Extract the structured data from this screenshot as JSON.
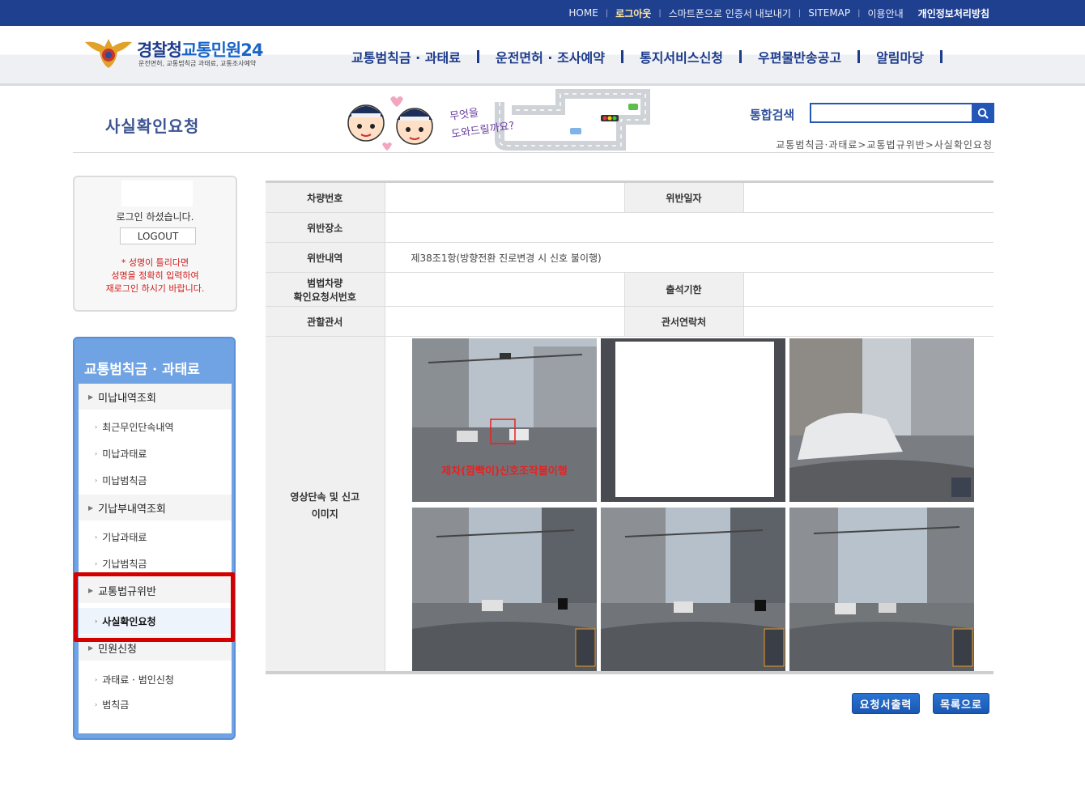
{
  "top_links": {
    "home": "HOME",
    "logout": "로그아웃",
    "export_cert": "스마트폰으로 인증서 내보내기",
    "sitemap": "SITEMAP",
    "guide": "이용안내",
    "privacy": "개인정보처리방침"
  },
  "logo": {
    "title_a": "경찰청",
    "title_b": "교통민원24",
    "subtitle": "운전면허, 교통범칙금 과태료, 교통조사예약"
  },
  "gnb": [
    "교통범칙금 · 과태료",
    "운전면허 · 조사예약",
    "통지서비스신청",
    "우편물반송공고",
    "알림마당"
  ],
  "page_title": "사실확인요청",
  "mascot_text": [
    "무엇을",
    "도와드릴까요?"
  ],
  "search": {
    "label": "통합검색",
    "placeholder": ""
  },
  "breadcrumb": "교통범칙금·과태료>교통법규위반>사실확인요청",
  "login": {
    "message": "로그인 하셨습니다.",
    "logout_label": "LOGOUT",
    "warning": [
      "* 성명이 틀리다면",
      "성명을 정확히 입력하여",
      "재로그인 하시기 바랍니다."
    ]
  },
  "lnb": {
    "title": "교통범칙금 · 과태료",
    "items": [
      {
        "label": "미납내역조회",
        "level": 1
      },
      {
        "label": "최근무인단속내역",
        "level": 2
      },
      {
        "label": "미납과태료",
        "level": 2
      },
      {
        "label": "미납범칙금",
        "level": 2
      },
      {
        "label": "기납부내역조회",
        "level": 1
      },
      {
        "label": "기납과태료",
        "level": 2
      },
      {
        "label": "기납범칙금",
        "level": 2
      },
      {
        "label": "교통법규위반",
        "level": 1
      },
      {
        "label": "사실확인요청",
        "level": 2,
        "active": true
      },
      {
        "label": "민원신청",
        "level": 1
      },
      {
        "label": "과태료 · 범인신청",
        "level": 2
      },
      {
        "label": "범칙금",
        "level": 2
      }
    ]
  },
  "detail": {
    "vehicle_no_label": "차량번호",
    "vehicle_no_value": "",
    "violation_date_label": "위반일자",
    "violation_date_value": "",
    "place_label": "위반장소",
    "place_value": "",
    "content_label": "위반내역",
    "content_value": "제38조1항(방향전환 진로변경 시 신호 불이행)",
    "request_no_label_1": "범법차량",
    "request_no_label_2": "확인요청서번호",
    "request_no_value": "",
    "deadline_label": "출석기한",
    "deadline_value": "",
    "office_label": "관할관서",
    "office_value": "",
    "contact_label": "관서연락처",
    "contact_value": "",
    "images_label_1": "영상단속 및 신고",
    "images_label_2": "이미지",
    "photo_caption": "제차(깜빡이)신호조작불이행"
  },
  "buttons": {
    "print": "요청서출력",
    "list": "목록으로"
  },
  "colors": {
    "top_bar": "#1f3f8f",
    "brand_blue": "#1e3c8c",
    "menu_blue": "#6fa3e3",
    "highlight_red": "#d40000"
  }
}
